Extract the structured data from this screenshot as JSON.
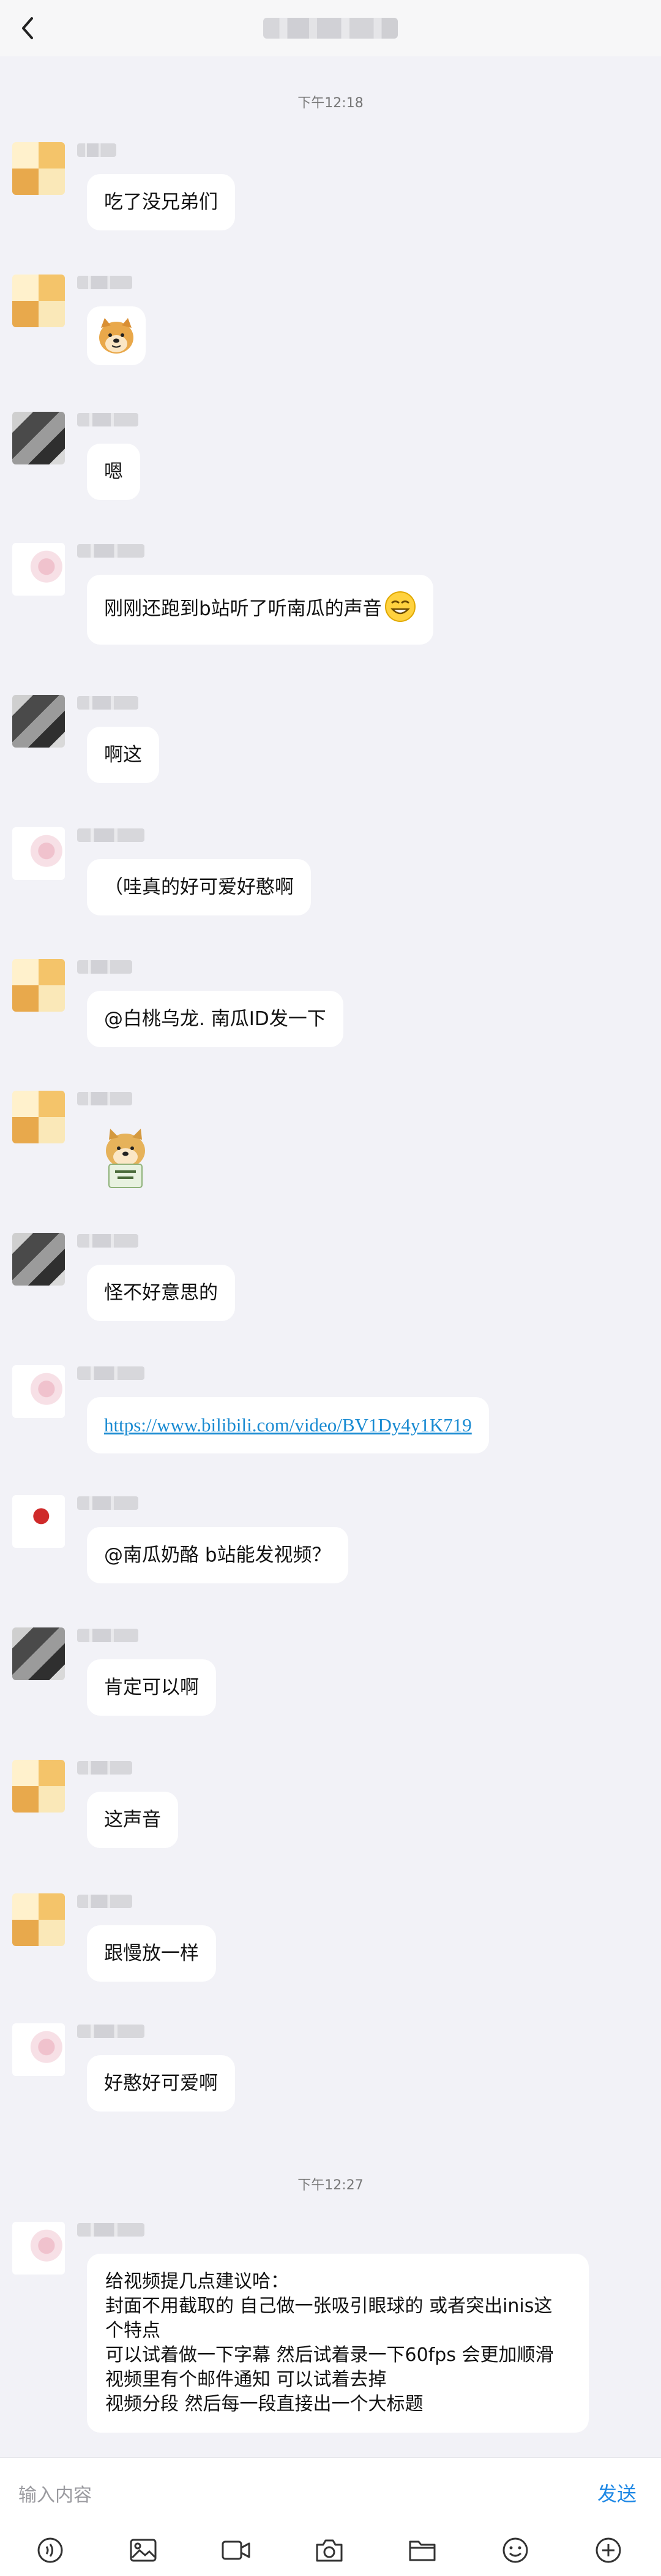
{
  "header": {
    "back_icon": "chevron-left-icon"
  },
  "times": [
    "下午12:18",
    "下午12:27"
  ],
  "messages": [
    {
      "type": "text",
      "text": "吃了没兄弟们",
      "avatar": "av1"
    },
    {
      "type": "sticker",
      "sticker": "doge-sticker-icon",
      "avatar": "av1"
    },
    {
      "type": "text",
      "text": "嗯",
      "avatar": "av2"
    },
    {
      "type": "text_emoji",
      "text": "刚刚还跑到b站听了听南瓜的声音",
      "emoji": "smile-emoji-icon",
      "avatar": "av3"
    },
    {
      "type": "text",
      "text": "啊这",
      "avatar": "av2"
    },
    {
      "type": "text",
      "text": "（哇真的好可爱好憨啊",
      "avatar": "av3"
    },
    {
      "type": "text",
      "text": "@白桃乌龙. 南瓜ID发一下",
      "avatar": "av1"
    },
    {
      "type": "sticker_plain",
      "sticker": "doge-sign-sticker-icon",
      "avatar": "av1"
    },
    {
      "type": "text",
      "text": "怪不好意思的",
      "avatar": "av2"
    },
    {
      "type": "link",
      "text": "https://www.bilibili.com/video/BV1Dy4y1K719",
      "avatar": "av3"
    },
    {
      "type": "text",
      "text": "@南瓜奶酪 b站能发视频？",
      "avatar": "av4"
    },
    {
      "type": "text",
      "text": "肯定可以啊",
      "avatar": "av2"
    },
    {
      "type": "text",
      "text": "这声音",
      "avatar": "av1"
    },
    {
      "type": "text",
      "text": "跟慢放一样",
      "avatar": "av1"
    },
    {
      "type": "text",
      "text": "好憨好可爱啊",
      "avatar": "av3"
    },
    {
      "type": "multiline",
      "lines": [
        "给视频提几点建议哈：",
        "封面不用截取的 自己做一张吸引眼球的 或者突出inis这个特点",
        "可以试着做一下字幕 然后试着录一下60fps 会更加顺滑",
        "视频里有个邮件通知 可以试着去掉",
        "视频分段 然后每一段直接出一个大标题"
      ],
      "avatar": "av3"
    }
  ],
  "input": {
    "placeholder": "输入内容",
    "send_label": "发送"
  },
  "toolbar": [
    "voice-icon",
    "image-icon",
    "video-icon",
    "camera-icon",
    "folder-icon",
    "emoji-icon",
    "plus-icon"
  ]
}
